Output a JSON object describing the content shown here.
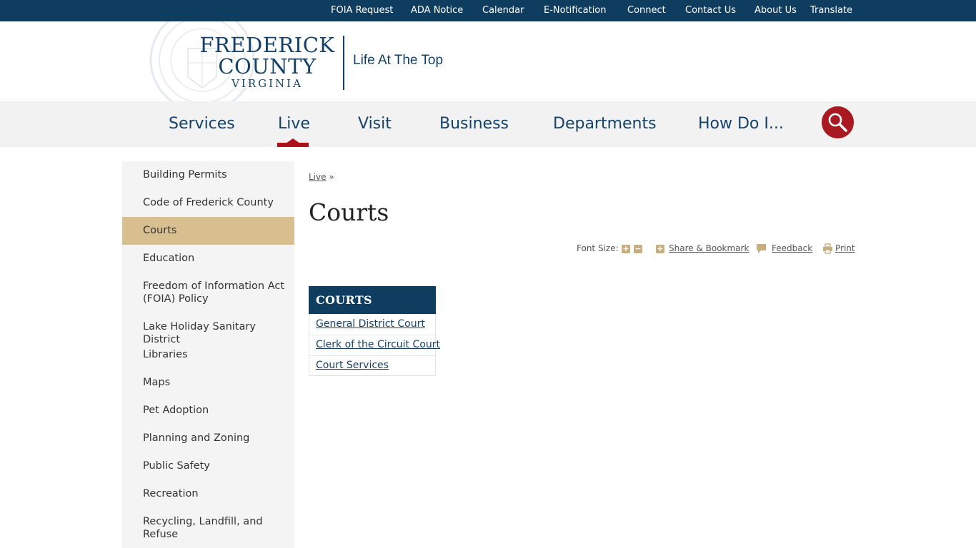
{
  "utility_nav": [
    "FOIA Request",
    "ADA Notice",
    "Calendar",
    "E-Notification",
    "Connect",
    "Contact Us",
    "About Us",
    "Translate"
  ],
  "logo": {
    "line1": "FREDERICK",
    "line2": "COUNTY",
    "line3": "VIRGINIA",
    "tagline": "Life At The Top"
  },
  "main_nav": {
    "items": [
      "Services",
      "Live",
      "Visit",
      "Business",
      "Departments",
      "How Do I..."
    ],
    "active": "Live"
  },
  "sidebar": {
    "items": [
      "Building Permits",
      "Code of Frederick County",
      "Courts",
      "Education",
      "Freedom of Information Act (FOIA) Policy",
      "Lake Holiday Sanitary District",
      "Libraries",
      "Maps",
      "Pet Adoption",
      "Planning and Zoning",
      "Public Safety",
      "Recreation",
      "Recycling, Landfill, and Refuse"
    ],
    "active": "Courts"
  },
  "breadcrumb": {
    "link": "Live",
    "separator": "»"
  },
  "page_title": "Courts",
  "tools": {
    "font_size_label": "Font Size:",
    "share": "Share & Bookmark",
    "feedback": "Feedback",
    "print": "Print"
  },
  "courts_box": {
    "title": "COURTS",
    "links": [
      "General District Court",
      "Clerk of the Circuit Court",
      "Court Services"
    ]
  },
  "colors": {
    "navy": "#0f3d5f",
    "accent_red": "#a81921",
    "sidebar_active": "#d8bf8f",
    "tool_icon": "#c8ae7e"
  },
  "icons": {
    "search": "search-icon",
    "font_increase": "plus-icon",
    "font_decrease": "minus-icon",
    "share": "plus-icon",
    "feedback": "speech-bubble-icon",
    "print": "printer-icon"
  }
}
